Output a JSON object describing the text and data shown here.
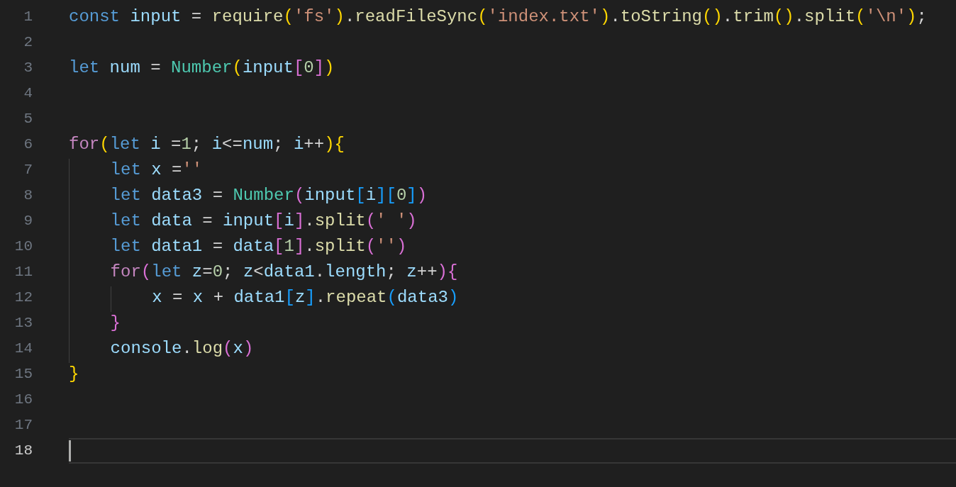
{
  "lines": [
    {
      "number": "1",
      "selected": false,
      "tokens": [
        {
          "kind": "kw",
          "text": "const "
        },
        {
          "kind": "var",
          "text": "input"
        },
        {
          "kind": "p",
          "text": " = "
        },
        {
          "kind": "fn",
          "text": "require"
        },
        {
          "kind": "b1",
          "text": "("
        },
        {
          "kind": "str",
          "text": "'fs'"
        },
        {
          "kind": "b1",
          "text": ")"
        },
        {
          "kind": "p",
          "text": "."
        },
        {
          "kind": "fn",
          "text": "readFileSync"
        },
        {
          "kind": "b1",
          "text": "("
        },
        {
          "kind": "str",
          "text": "'index.txt'"
        },
        {
          "kind": "b1",
          "text": ")"
        },
        {
          "kind": "p",
          "text": "."
        },
        {
          "kind": "fn",
          "text": "toString"
        },
        {
          "kind": "b1",
          "text": "()"
        },
        {
          "kind": "p",
          "text": "."
        },
        {
          "kind": "fn",
          "text": "trim"
        },
        {
          "kind": "b1",
          "text": "()"
        },
        {
          "kind": "p",
          "text": "."
        },
        {
          "kind": "fn",
          "text": "split"
        },
        {
          "kind": "b1",
          "text": "("
        },
        {
          "kind": "str",
          "text": "'\\n'"
        },
        {
          "kind": "b1",
          "text": ")"
        },
        {
          "kind": "p",
          "text": ";"
        }
      ]
    },
    {
      "number": "2",
      "selected": false
    },
    {
      "number": "3",
      "selected": false,
      "tokens": [
        {
          "kind": "kw",
          "text": "let "
        },
        {
          "kind": "var",
          "text": "num"
        },
        {
          "kind": "p",
          "text": " = "
        },
        {
          "kind": "cls",
          "text": "Number"
        },
        {
          "kind": "b1",
          "text": "("
        },
        {
          "kind": "var",
          "text": "input"
        },
        {
          "kind": "b2",
          "text": "["
        },
        {
          "kind": "num",
          "text": "0"
        },
        {
          "kind": "b2",
          "text": "]"
        },
        {
          "kind": "b1",
          "text": ")"
        }
      ]
    },
    {
      "number": "4",
      "selected": false
    },
    {
      "number": "5",
      "selected": false
    },
    {
      "number": "6",
      "selected": false,
      "tokens": [
        {
          "kind": "ctl",
          "text": "for"
        },
        {
          "kind": "b1",
          "text": "("
        },
        {
          "kind": "kw",
          "text": "let "
        },
        {
          "kind": "var",
          "text": "i"
        },
        {
          "kind": "p",
          "text": " ="
        },
        {
          "kind": "num",
          "text": "1"
        },
        {
          "kind": "p",
          "text": "; "
        },
        {
          "kind": "var",
          "text": "i"
        },
        {
          "kind": "p",
          "text": "<="
        },
        {
          "kind": "var",
          "text": "num"
        },
        {
          "kind": "p",
          "text": "; "
        },
        {
          "kind": "var",
          "text": "i"
        },
        {
          "kind": "p",
          "text": "++"
        },
        {
          "kind": "b1",
          "text": ")"
        },
        {
          "kind": "b1",
          "text": "{"
        }
      ]
    },
    {
      "number": "7",
      "selected": false,
      "tokens": [
        {
          "kind": "kw",
          "text": "    let "
        },
        {
          "kind": "var",
          "text": "x"
        },
        {
          "kind": "p",
          "text": " ="
        },
        {
          "kind": "str",
          "text": "''"
        }
      ]
    },
    {
      "number": "8",
      "selected": false,
      "tokens": [
        {
          "kind": "kw",
          "text": "    let "
        },
        {
          "kind": "var",
          "text": "data3"
        },
        {
          "kind": "p",
          "text": " = "
        },
        {
          "kind": "cls",
          "text": "Number"
        },
        {
          "kind": "b2",
          "text": "("
        },
        {
          "kind": "var",
          "text": "input"
        },
        {
          "kind": "b3",
          "text": "["
        },
        {
          "kind": "var",
          "text": "i"
        },
        {
          "kind": "b3",
          "text": "]["
        },
        {
          "kind": "num",
          "text": "0"
        },
        {
          "kind": "b3",
          "text": "]"
        },
        {
          "kind": "b2",
          "text": ")"
        }
      ]
    },
    {
      "number": "9",
      "selected": false,
      "tokens": [
        {
          "kind": "kw",
          "text": "    let "
        },
        {
          "kind": "var",
          "text": "data"
        },
        {
          "kind": "p",
          "text": " = "
        },
        {
          "kind": "var",
          "text": "input"
        },
        {
          "kind": "b2",
          "text": "["
        },
        {
          "kind": "var",
          "text": "i"
        },
        {
          "kind": "b2",
          "text": "]"
        },
        {
          "kind": "p",
          "text": "."
        },
        {
          "kind": "fn",
          "text": "split"
        },
        {
          "kind": "b2",
          "text": "("
        },
        {
          "kind": "str",
          "text": "' '"
        },
        {
          "kind": "b2",
          "text": ")"
        }
      ]
    },
    {
      "number": "10",
      "selected": false,
      "tokens": [
        {
          "kind": "kw",
          "text": "    let "
        },
        {
          "kind": "var",
          "text": "data1"
        },
        {
          "kind": "p",
          "text": " = "
        },
        {
          "kind": "var",
          "text": "data"
        },
        {
          "kind": "b2",
          "text": "["
        },
        {
          "kind": "num",
          "text": "1"
        },
        {
          "kind": "b2",
          "text": "]"
        },
        {
          "kind": "p",
          "text": "."
        },
        {
          "kind": "fn",
          "text": "split"
        },
        {
          "kind": "b2",
          "text": "("
        },
        {
          "kind": "str",
          "text": "''"
        },
        {
          "kind": "b2",
          "text": ")"
        }
      ]
    },
    {
      "number": "11",
      "selected": false,
      "tokens": [
        {
          "kind": "ctl",
          "text": "    for"
        },
        {
          "kind": "b2",
          "text": "("
        },
        {
          "kind": "kw",
          "text": "let "
        },
        {
          "kind": "var",
          "text": "z"
        },
        {
          "kind": "p",
          "text": "="
        },
        {
          "kind": "num",
          "text": "0"
        },
        {
          "kind": "p",
          "text": "; "
        },
        {
          "kind": "var",
          "text": "z"
        },
        {
          "kind": "p",
          "text": "<"
        },
        {
          "kind": "var",
          "text": "data1"
        },
        {
          "kind": "p",
          "text": "."
        },
        {
          "kind": "var",
          "text": "length"
        },
        {
          "kind": "p",
          "text": "; "
        },
        {
          "kind": "var",
          "text": "z"
        },
        {
          "kind": "p",
          "text": "++"
        },
        {
          "kind": "b2",
          "text": "){"
        }
      ]
    },
    {
      "number": "12",
      "selected": false,
      "tokens": [
        {
          "kind": "var",
          "text": "        x"
        },
        {
          "kind": "p",
          "text": " = "
        },
        {
          "kind": "var",
          "text": "x"
        },
        {
          "kind": "p",
          "text": " + "
        },
        {
          "kind": "var",
          "text": "data1"
        },
        {
          "kind": "b3",
          "text": "["
        },
        {
          "kind": "var",
          "text": "z"
        },
        {
          "kind": "b3",
          "text": "]"
        },
        {
          "kind": "p",
          "text": "."
        },
        {
          "kind": "fn",
          "text": "repeat"
        },
        {
          "kind": "b3",
          "text": "("
        },
        {
          "kind": "var",
          "text": "data3"
        },
        {
          "kind": "b3",
          "text": ")"
        }
      ]
    },
    {
      "number": "13",
      "selected": false,
      "tokens": [
        {
          "kind": "b2",
          "text": "    }"
        }
      ]
    },
    {
      "number": "14",
      "selected": false,
      "tokens": [
        {
          "kind": "var",
          "text": "    console"
        },
        {
          "kind": "p",
          "text": "."
        },
        {
          "kind": "fn",
          "text": "log"
        },
        {
          "kind": "b2",
          "text": "("
        },
        {
          "kind": "var",
          "text": "x"
        },
        {
          "kind": "b2",
          "text": ")"
        }
      ]
    },
    {
      "number": "15",
      "selected": false,
      "tokens": [
        {
          "kind": "b1",
          "text": "}"
        }
      ]
    },
    {
      "number": "16",
      "selected": false
    },
    {
      "number": "17",
      "selected": false
    },
    {
      "number": "18",
      "selected": true
    }
  ]
}
